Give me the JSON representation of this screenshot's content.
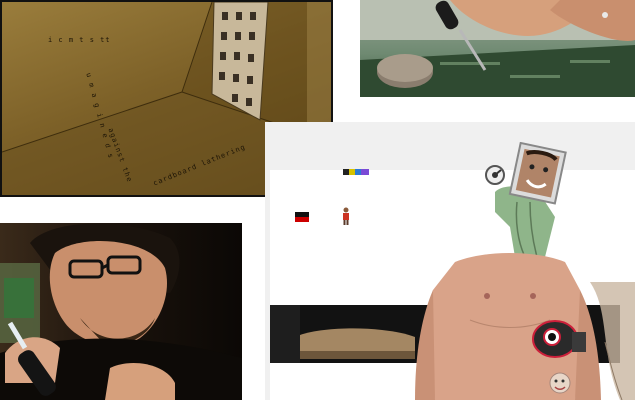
{
  "cardboard_panel": {
    "text_lines": {
      "top": "i c m t s tt",
      "right_vertical": "u m a g i n e d s",
      "bottom_a": "against the",
      "bottom_b": "cardboard lathering"
    },
    "colors": {
      "cardboard": "#8a6e30",
      "border": "#111111"
    }
  },
  "solder_panel": {
    "colors": {
      "board": "#3e5a3f",
      "skin": "#d9a07a"
    }
  },
  "man_panel": {
    "colors": {
      "background": "#1a120c",
      "skin": "#c99070"
    }
  },
  "app_panel": {
    "colors": {
      "frame": "#f0f0f0",
      "stage": "#ffffff",
      "torso": "#d9a389",
      "green_cloth": "#8fb58a",
      "dark_band": "#111111",
      "tag_red": "#cc0000",
      "tag_black": "#222222"
    },
    "icons": [
      "color-swatch-icon",
      "flag-icon",
      "figure-icon",
      "tv-face-icon",
      "dial-icon",
      "eye-icon"
    ]
  }
}
